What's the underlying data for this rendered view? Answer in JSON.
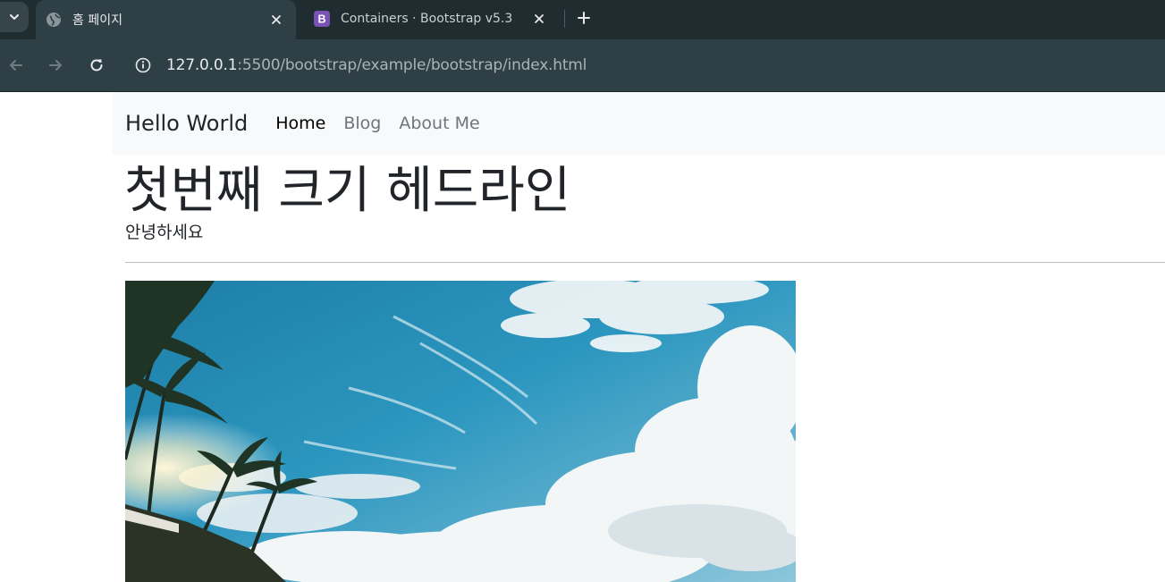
{
  "browser": {
    "tabs": [
      {
        "title": "홈 페이지",
        "icon": "globe-icon",
        "active": true
      },
      {
        "title": "Containers · Bootstrap v5.3",
        "icon": "bootstrap-icon",
        "favicon_letter": "B",
        "active": false
      }
    ],
    "url": {
      "host": "127.0.0.1",
      "rest": ":5500/bootstrap/example/bootstrap/index.html"
    },
    "colors": {
      "tabbar": "#1f2d31",
      "toolbar": "#2e4046",
      "bootstrap_purple": "#7952b3"
    }
  },
  "page": {
    "navbar": {
      "brand": "Hello World",
      "links": [
        {
          "label": "Home",
          "active": true
        },
        {
          "label": "Blog",
          "active": false
        },
        {
          "label": "About Me",
          "active": false
        }
      ]
    },
    "headline": "첫번째 크기 헤드라인",
    "lead": "안녕하세요",
    "image": {
      "alt": "tropical sky with palm trees and clouds"
    }
  }
}
